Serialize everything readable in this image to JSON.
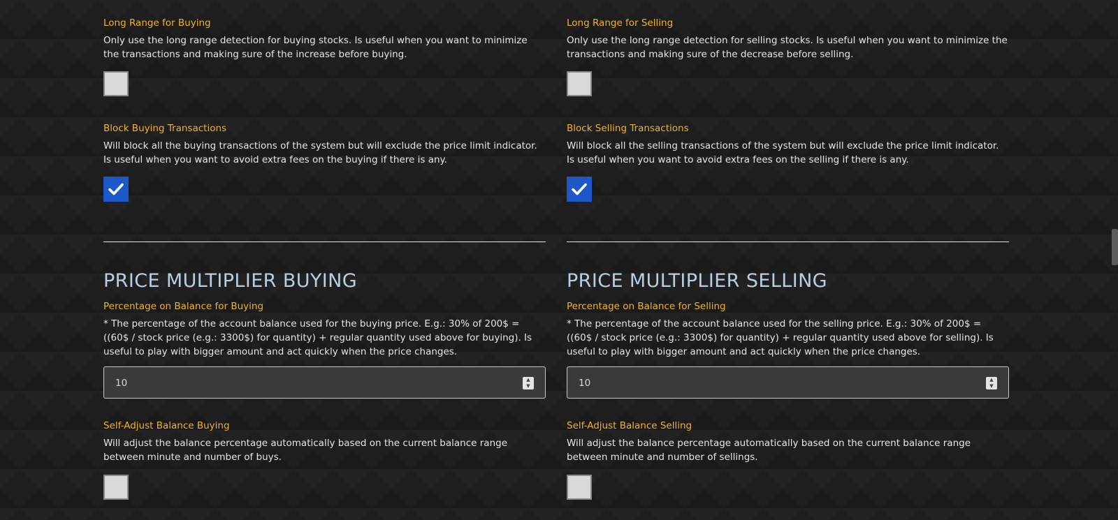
{
  "left": {
    "long_range": {
      "label": "Long Range for Buying",
      "desc": "Only use the long range detection for buying stocks. Is useful when you want to minimize the transactions and making sure of the increase before buying.",
      "checked": false
    },
    "block": {
      "label": "Block Buying Transactions",
      "desc": "Will block all the buying transactions of the system but will exclude the price limit indicator. Is useful when you want to avoid extra fees on the buying if there is any.",
      "checked": true
    },
    "section_title": "PRICE MULTIPLIER BUYING",
    "percentage": {
      "label": "Percentage on Balance for Buying",
      "desc": "* The percentage of the account balance used for the buying price. E.g.: 30% of 200$ = ((60$ / stock price (e.g.: 3300$) for quantity) + regular quantity used above for buying). Is useful to play with bigger amount and act quickly when the price changes.",
      "value": "10"
    },
    "self_adjust": {
      "label": "Self-Adjust Balance Buying",
      "desc": "Will adjust the balance percentage automatically based on the current balance range between minute and number of buys.",
      "checked": false
    }
  },
  "right": {
    "long_range": {
      "label": "Long Range for Selling",
      "desc": "Only use the long range detection for selling stocks. Is useful when you want to minimize the transactions and making sure of the decrease before selling.",
      "checked": false
    },
    "block": {
      "label": "Block Selling Transactions",
      "desc": "Will block all the selling transactions of the system but will exclude the price limit indicator. Is useful when you want to avoid extra fees on the selling if there is any.",
      "checked": true
    },
    "section_title": "PRICE MULTIPLIER SELLING",
    "percentage": {
      "label": "Percentage on Balance for Selling",
      "desc": "* The percentage of the account balance used for the selling price. E.g.: 30% of 200$ = ((60$ / stock price (e.g.: 3300$) for quantity) + regular quantity used above for selling). Is useful to play with bigger amount and act quickly when the price changes.",
      "value": "10"
    },
    "self_adjust": {
      "label": "Self-Adjust Balance Selling",
      "desc": "Will adjust the balance percentage automatically based on the current balance range between minute and number of sellings.",
      "checked": false
    }
  },
  "colors": {
    "label": "#f0b429",
    "title": "#b9cde3",
    "checked": "#1e57c8",
    "background": "#1e1e1e"
  },
  "icons": {
    "checkmark": "check-icon",
    "spinner_up": "spin-up-icon",
    "spinner_down": "spin-down-icon"
  }
}
